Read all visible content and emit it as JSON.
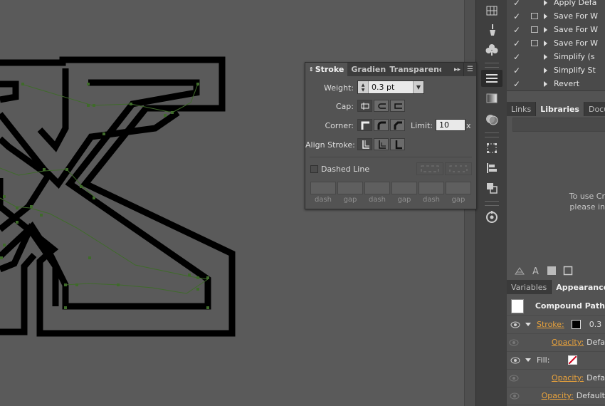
{
  "stroke_panel": {
    "tabs": [
      {
        "label": "Stroke"
      },
      {
        "label": "Gradient"
      },
      {
        "label": "Transparency"
      }
    ],
    "weight_label": "Weight:",
    "weight_value": "0.3 pt",
    "cap_label": "Cap:",
    "corner_label": "Corner:",
    "limit_label": "Limit:",
    "limit_value": "10",
    "limit_unit": "x",
    "align_label": "Align Stroke:",
    "dashed_label": "Dashed Line",
    "dashed_checked": false,
    "dash_gap_labels": [
      "dash",
      "gap",
      "dash",
      "gap",
      "dash",
      "gap"
    ]
  },
  "actions": {
    "items": [
      {
        "label": "Apply Defa",
        "checked": true,
        "has_box": false
      },
      {
        "label": "Save For W",
        "checked": true,
        "has_box": true
      },
      {
        "label": "Save For W",
        "checked": true,
        "has_box": true
      },
      {
        "label": "Save For W",
        "checked": true,
        "has_box": true
      },
      {
        "label": "Simplify (s",
        "checked": true,
        "has_box": false
      },
      {
        "label": "Simplify St",
        "checked": true,
        "has_box": false
      },
      {
        "label": "Revert",
        "checked": true,
        "has_box": false
      }
    ]
  },
  "libraries": {
    "tabs": [
      {
        "label": "Links"
      },
      {
        "label": "Libraries"
      },
      {
        "label": "Docum"
      }
    ],
    "message_line1": "To use Cr",
    "message_line2": "please in"
  },
  "appearance": {
    "tabs": [
      {
        "label": "Variables"
      },
      {
        "label": "Appearance"
      }
    ],
    "object_label": "Compound Path",
    "stroke_label": "Stroke:",
    "stroke_value": "0.3",
    "opacity_label": "Opacity:",
    "opacity_value": "Defa",
    "fill_label": "Fill:",
    "fill_opacity_value": "Defa",
    "object_opacity_value": "Default"
  },
  "colors": {
    "canvas": "#5a5a5a",
    "path_anchor": "#3f6b2a",
    "link_orange": "#e8a23c"
  }
}
